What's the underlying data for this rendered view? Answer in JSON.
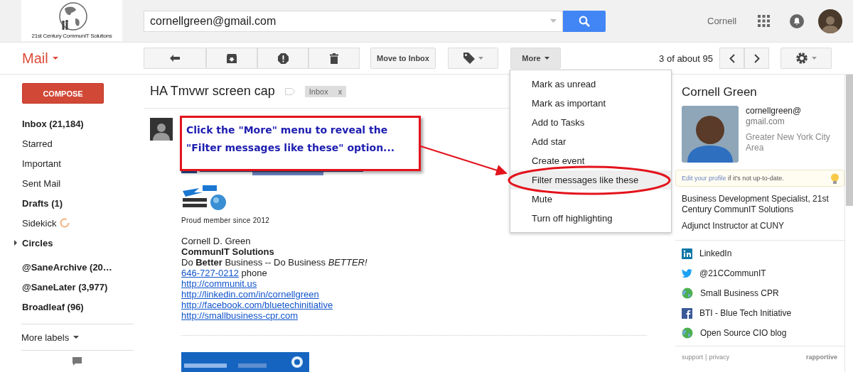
{
  "logo": {
    "text": "21st Century CommunIT Solutions"
  },
  "search": {
    "value": "cornellgreen@gmail.com"
  },
  "account": {
    "name": "Cornell"
  },
  "app_title": "Mail",
  "toolbar": {
    "move_to_inbox": "Move to Inbox",
    "more": "More",
    "pagination": "3 of about 95"
  },
  "compose": "COMPOSE",
  "sidebar": {
    "items": [
      {
        "label": "Inbox (21,184)",
        "unread": true,
        "kind": "plain"
      },
      {
        "label": "Starred",
        "unread": false,
        "kind": "plain"
      },
      {
        "label": "Important",
        "unread": false,
        "kind": "plain"
      },
      {
        "label": "Sent Mail",
        "unread": false,
        "kind": "plain"
      },
      {
        "label": "Drafts (1)",
        "unread": true,
        "kind": "plain"
      },
      {
        "label": "Sidekick",
        "unread": false,
        "kind": "spinner"
      },
      {
        "label": "Circles",
        "unread": true,
        "kind": "group",
        "expanded": false
      },
      {
        "label": "@SaneArchive (20…",
        "unread": true,
        "kind": "plain"
      },
      {
        "label": "@SaneLater (3,977)",
        "unread": true,
        "kind": "plain"
      },
      {
        "label": "Broadleaf (96)",
        "unread": true,
        "kind": "plain"
      }
    ],
    "more_labels": "More labels"
  },
  "thread": {
    "subject": "HA Tmvwr screen cap",
    "label": "Inbox",
    "label_close": "x"
  },
  "message": {
    "proud": "Proud member since 2012",
    "signature": [
      {
        "text": "Cornell D. Green",
        "kind": "plain"
      },
      {
        "text": "CommunIT Solutions",
        "kind": "bold"
      },
      {
        "text": "Do **Better** Business -- Do Business *BETTER!*",
        "kind": "plain"
      },
      {
        "text": "646-727-0212",
        "suffix": " phone",
        "kind": "phone"
      },
      {
        "text": "http://communit.us",
        "kind": "link"
      },
      {
        "text": "http://linkedin.com/in/cornellgreen",
        "kind": "link"
      },
      {
        "text": "http://facebook.com/bluetechinitiative",
        "kind": "link"
      },
      {
        "text": "http://smallbusiness-cpr.com",
        "kind": "link"
      }
    ]
  },
  "menu": {
    "items": [
      {
        "label": "Mark as unread",
        "selected": false
      },
      {
        "label": "Mark as important",
        "selected": false
      },
      {
        "label": "Add to Tasks",
        "selected": false
      },
      {
        "label": "Add star",
        "selected": false
      },
      {
        "label": "Create event",
        "selected": false
      },
      {
        "label": "Filter messages like these",
        "selected": true
      },
      {
        "label": "Mute",
        "selected": false
      },
      {
        "label": "Turn off highlighting",
        "selected": false
      }
    ]
  },
  "callout": {
    "text": "Click the \"More\" menu to reveal the\n\"Filter messages like these\" option..."
  },
  "profile": {
    "name": "Cornell Green",
    "email_lines": [
      "cornellgreen@",
      "gmail.com"
    ],
    "location": "Greater New York City Area",
    "edit_link": "Edit your profile",
    "edit_rest": " if it's not up-to-date.",
    "jobs": [
      "Business Development Specialist, 21st Century CommunIT Solutions",
      "Adjunct Instructor at CUNY"
    ],
    "links": [
      {
        "label": "LinkedIn",
        "kind": "linkedin"
      },
      {
        "label": "@21CCommunIT",
        "kind": "twitter"
      },
      {
        "label": "Small Business CPR",
        "kind": "web"
      },
      {
        "label": "BTI - Blue Tech Initiative",
        "kind": "facebook"
      },
      {
        "label": "Open Source CIO blog",
        "kind": "web"
      }
    ],
    "footer": {
      "support": "support",
      "separator": "|",
      "privacy": "privacy",
      "brand": "rapportive"
    }
  }
}
